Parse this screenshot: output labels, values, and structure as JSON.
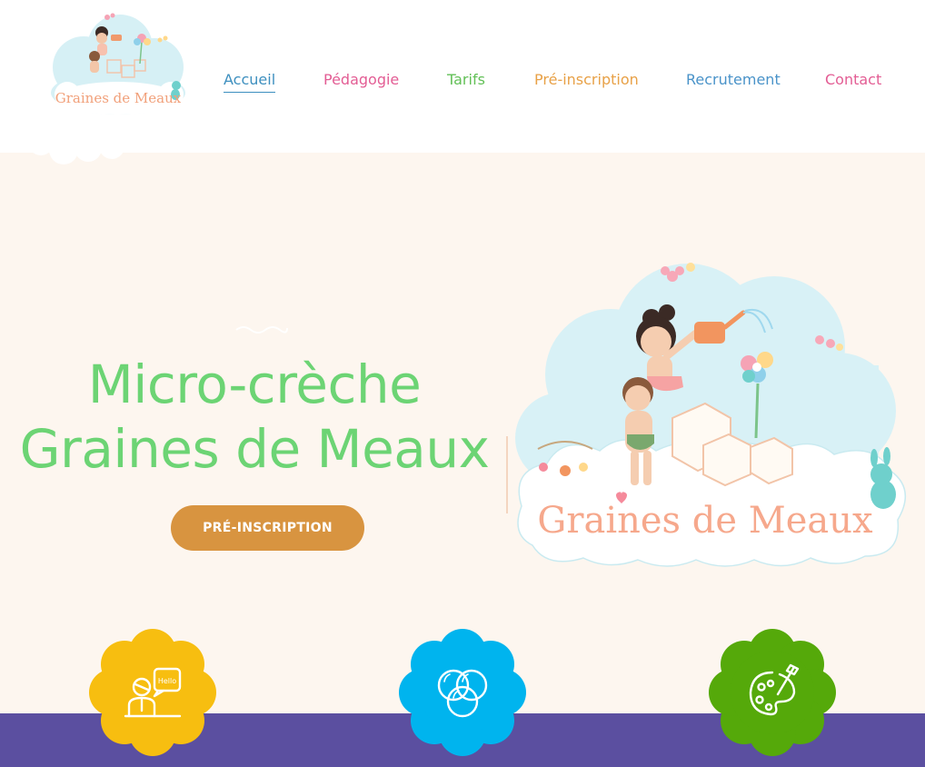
{
  "brand": {
    "logo_text": "Graines de Meaux"
  },
  "nav": {
    "items": [
      {
        "label": "Accueil",
        "color": "#3d8fbf",
        "active": true
      },
      {
        "label": "Pédagogie",
        "color": "#e35d94"
      },
      {
        "label": "Tarifs",
        "color": "#62c057"
      },
      {
        "label": "Pré-inscription",
        "color": "#e8a147"
      },
      {
        "label": "Recrutement",
        "color": "#4a93c9"
      },
      {
        "label": "Contact",
        "color": "#e35d94"
      }
    ]
  },
  "hero": {
    "title_line1": "Micro-crèche",
    "title_line2": "Graines de Meaux",
    "cta_label": "PRÉ-INSCRIPTION",
    "illustration_text": "Graines de Meaux"
  },
  "features": [
    {
      "icon": "language-teacher-icon",
      "icon_text": "Hello",
      "color": "#f7be10"
    },
    {
      "icon": "bubbles-icon",
      "color": "#00b4ee"
    },
    {
      "icon": "paint-palette-icon",
      "color": "#55a90a"
    }
  ],
  "colors": {
    "hero_title": "#6cd474",
    "cta": "#d89440",
    "band": "#5b4fa0",
    "background": "#fdf6ef"
  }
}
